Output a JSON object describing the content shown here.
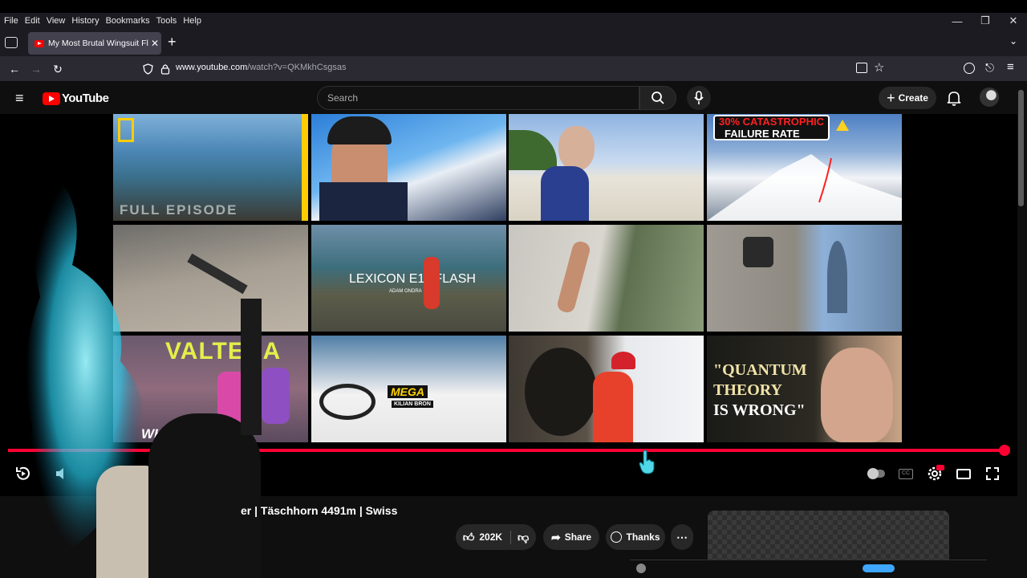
{
  "browser": {
    "menu": [
      "File",
      "Edit",
      "View",
      "History",
      "Bookmarks",
      "Tools",
      "Help"
    ],
    "tab_title": "My Most Brutal Wingsuit Flight",
    "url_host": "www.youtube.com",
    "url_path": "/watch?v=QKMkhCsgsas"
  },
  "youtube": {
    "logo_text": "YouTube",
    "search_placeholder": "Search",
    "create_label": "Create"
  },
  "end_screen": {
    "tiles": [
      {
        "caption": "FULL EPISODE"
      },
      {
        "caption": ""
      },
      {
        "caption": ""
      },
      {
        "caption": "30% CATASTROPHIC",
        "caption2": "FAILURE RATE"
      },
      {
        "caption": ""
      },
      {
        "caption": "LEXICON E11 FLASH",
        "caption2": "ADAM ONDRA"
      },
      {
        "caption": ""
      },
      {
        "caption": ""
      },
      {
        "caption": "VALTERA",
        "caption2": "WHO...ED??"
      },
      {
        "caption": "MEGA",
        "caption2": "KILIAN BRON"
      },
      {
        "caption": ""
      },
      {
        "caption": "\"QUANTUM",
        "caption2": "THEORY",
        "caption3": "IS WRONG\""
      }
    ]
  },
  "player": {
    "progress": 0.995
  },
  "video": {
    "title": "er | Täschhorn 4491m | Swiss",
    "like_count": "202K",
    "share_label": "Share",
    "thanks_label": "Thanks"
  },
  "colors": {
    "accent": "#ff0033",
    "brand_red": "#ff0000"
  }
}
